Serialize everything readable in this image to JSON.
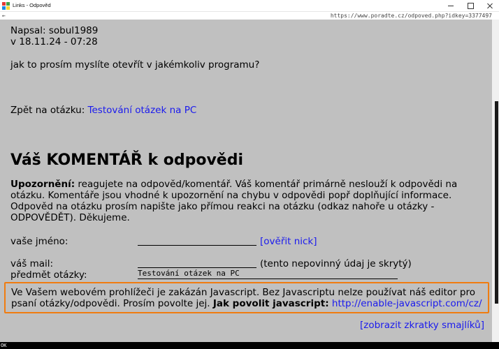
{
  "window": {
    "title": "Links - Odpověd",
    "url": "https://www.poradte.cz/odpoved.php?idkey=3377497"
  },
  "post": {
    "author": "Napsal: sobul1989",
    "date": "v 18.11.24 - 07:28",
    "text": "jak to prosím myslíte otevřít v jakémkoliv programu?"
  },
  "back": {
    "prefix": "Zpět na otázku: ",
    "link": "Testování otázek na PC"
  },
  "comment": {
    "heading": "Váš KOMENTÁŘ k odpovědi",
    "warning_bold": "Upozornění:",
    "warning_line1_rest": " reagujete na odpovĕd/komentář. Váš komentář primárně neslouží k odpovědi na",
    "warning_line2": "otázku. Komentáře jsou vhodné k upozornění na chybu v odpovědi popř doplňující informace.",
    "warning_line3": "Odpověd na otázku prosím napište jako přímou reakci na otázku (odkaz nahoře u otázky -",
    "warning_line4": "ODPOVĚDĚT). Děkujeme."
  },
  "form": {
    "name_label": "vaše jméno:",
    "name_value": "",
    "verify_link": "[ověřit nick]",
    "mail_label": "váš mail:",
    "mail_value": "",
    "mail_note": "(tento nepovinný údaj je skrytý)",
    "subject_label": "předmět otázky:",
    "subject_value": "Testování otázek na PC"
  },
  "js_notice": {
    "line1": "Ve Vašem webovém prohlížeči je zakázán Javascript. Bez Javascriptu nelze používat náš editor pro",
    "line2_text": "psaní otázky/odpovědi. Prosím povolte jej. ",
    "line2_bold": "Jak povolit javascript:",
    "line2_link": "http://enable-javascript.com/cz/"
  },
  "smileys_link": "[zobrazit zkratky smajlíků]",
  "bottom": {
    "status": "OK"
  },
  "colors": {
    "background": "#c0c0c0",
    "link": "#1a1aee",
    "highlight": "#f07c10"
  }
}
